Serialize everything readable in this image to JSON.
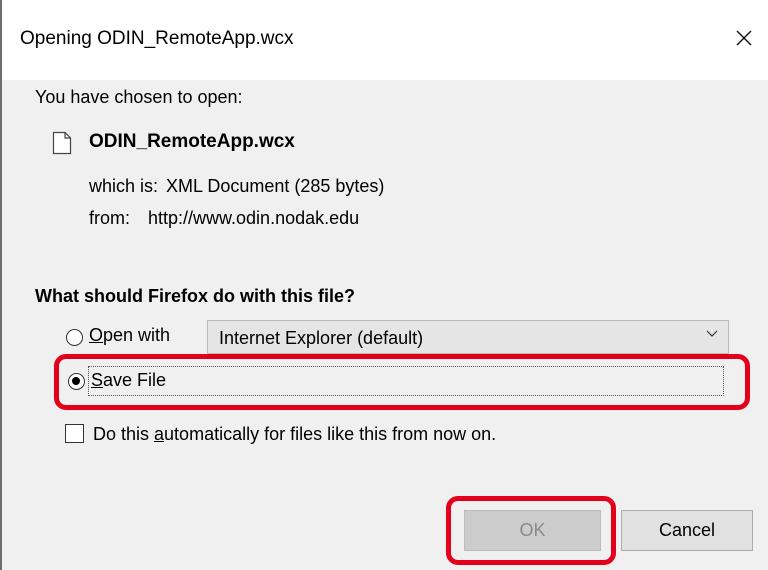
{
  "window": {
    "title": "Opening ODIN_RemoteApp.wcx",
    "close_icon": "close-icon"
  },
  "file_info": {
    "intro": "You have chosen to open:",
    "file_icon": "document-icon",
    "filename": "ODIN_RemoteApp.wcx",
    "type_label": "which is:",
    "type_value": "XML Document (285 bytes)",
    "from_label": "from:",
    "from_value": "http://www.odin.nodak.edu"
  },
  "action": {
    "question": "What should Firefox do with this file?",
    "open_with": {
      "accesskey": "O",
      "label_rest": "pen with",
      "selected": false,
      "app_select_value": "Internet Explorer (default)",
      "chevron_icon": "chevron-down-icon"
    },
    "save_file": {
      "accesskey": "S",
      "label_rest": "ave File",
      "selected": true
    },
    "auto": {
      "label_before": "Do this ",
      "accesskey": "a",
      "label_after": "utomatically for files like this from now on.",
      "checked": false
    }
  },
  "buttons": {
    "ok_label": "OK",
    "ok_enabled": false,
    "cancel_label": "Cancel"
  },
  "annotations": {
    "color": "#e4001b",
    "targets": [
      "save-file-option",
      "ok-button"
    ]
  }
}
